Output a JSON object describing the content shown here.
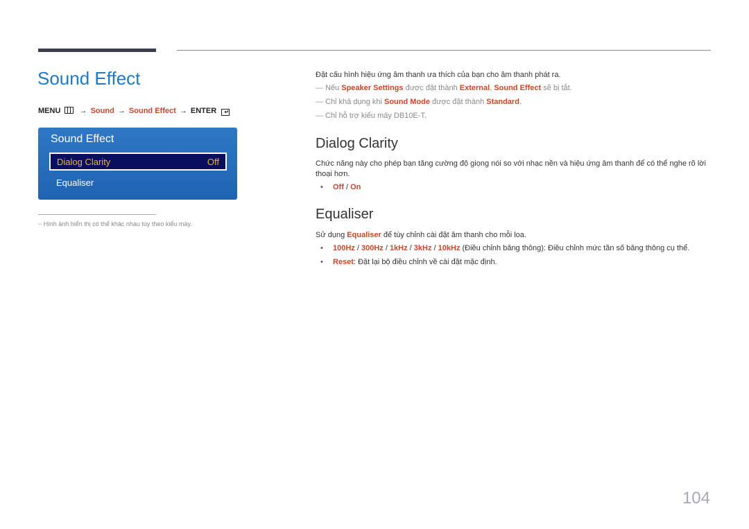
{
  "header": {
    "title": "Sound Effect"
  },
  "menu_path": {
    "menu": "MENU",
    "menu_icon": "menu-grid-icon",
    "arrow": "→",
    "steps": [
      "Sound",
      "Sound Effect"
    ],
    "enter": "ENTER",
    "enter_icon": "enter-icon"
  },
  "osd": {
    "title": "Sound Effect",
    "items": [
      {
        "label": "Dialog Clarity",
        "value": "Off",
        "selected": true
      },
      {
        "label": "Equaliser",
        "value": "",
        "selected": false
      }
    ],
    "colors": {
      "panel": "#2a70bf",
      "selected_bg": "#0a0e5e",
      "selected_text": "#e8b43a"
    }
  },
  "footnote": "−  Hình ảnh hiển thị có thể khác nhau tùy theo kiểu máy.",
  "intro": "Đặt cấu hình hiệu ứng âm thanh ưa thích của bạn cho âm thanh phát ra.",
  "notes": [
    {
      "dash": "—",
      "t1": "Nếu ",
      "h1": "Speaker Settings",
      "t2": " được đặt thành ",
      "h2": "External",
      "t3": ", ",
      "h3": "Sound Effect",
      "t4": " sẽ bị tắt."
    },
    {
      "dash": "—",
      "t1": "Chỉ khả dụng khi ",
      "h1": "Sound Mode",
      "t2": " được đặt thành ",
      "h2": "Standard",
      "t3": "."
    },
    {
      "dash": "—",
      "t1": "Chỉ hỗ trợ kiểu máy DB10E-T."
    }
  ],
  "dialog_clarity": {
    "heading": "Dialog Clarity",
    "description": "Chức năng này cho phép bạn tăng cường độ giọng nói so với nhạc nền và hiệu ứng âm thanh để có thể nghe rõ lời thoại hơn.",
    "options": {
      "bullet": "•",
      "off": "Off",
      "sep": " / ",
      "on": "On"
    }
  },
  "equaliser": {
    "heading": "Equaliser",
    "desc_pre": "Sử dụng ",
    "desc_hl": "Equaliser",
    "desc_post": " để tùy chỉnh cài đặt âm thanh cho mỗi loa.",
    "bands": [
      "100Hz",
      "300Hz",
      "1kHz",
      "3kHz",
      "10kHz"
    ],
    "band_sep": " / ",
    "bands_desc": " (Điều chỉnh băng thông): Điều chỉnh mức tần số băng thông cụ thể.",
    "reset_label": "Reset",
    "reset_desc": ": Đặt lại bộ điều chỉnh về cài đặt mặc định.",
    "bullet": "•"
  },
  "colors": {
    "title_blue": "#1f7ac4",
    "highlight": "#c8462a"
  },
  "page_number": "104"
}
